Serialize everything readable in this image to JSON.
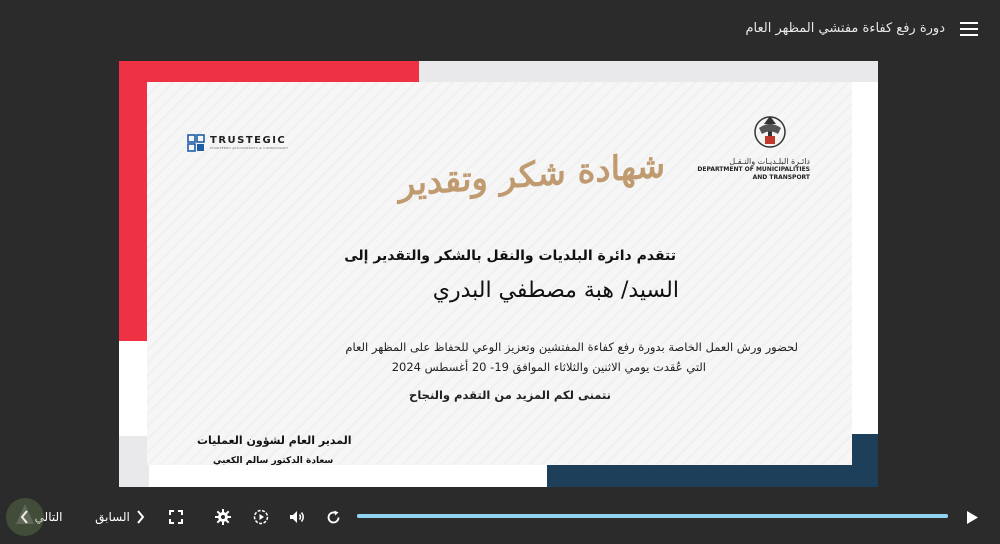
{
  "header": {
    "course_title": "دورة رفع كفاءة مفتشي المظهر العام"
  },
  "certificate": {
    "dept_ar": "دائـرة البلـديـات والنـقـل",
    "dept_en_line1": "DEPARTMENT OF MUNICIPALITIES",
    "dept_en_line2": "AND TRANSPORT",
    "brand_name": "TRUSTEGIC",
    "brand_sub": "CHARTERED ACCOUNTANTS & CONSULTANCY",
    "title": "شهادة شكر وتقدير",
    "intro": "تتقدم دائرة البلديات والنقل بالشكر والتقدير إلى",
    "recipient": "السيد/ هبة مصطفي البدري",
    "line1": "لحضور ورش العمل الخاصة بدورة رفع كفاءة المفتشين وتعزيز الوعي للحفاظ على المظهر العام",
    "line2": "التي عُقدت يومي الاثنين والثلاثاء الموافق 19- 20 أغسطس 2024",
    "wish": "نتمنى لكم المزيد من التقدم والنجاح",
    "sign_title": "المدير العام لشؤون العمليات",
    "sign_name": "سعادة الدكتور سالم الكعبي"
  },
  "controls": {
    "next_label": "التالي",
    "prev_label": "السابق",
    "progress_percent": 100,
    "colors": {
      "progress": "#8fd3f0",
      "accent_red": "#ee3243",
      "accent_blue": "#1d3f5a",
      "gold": "#c09b70"
    }
  }
}
